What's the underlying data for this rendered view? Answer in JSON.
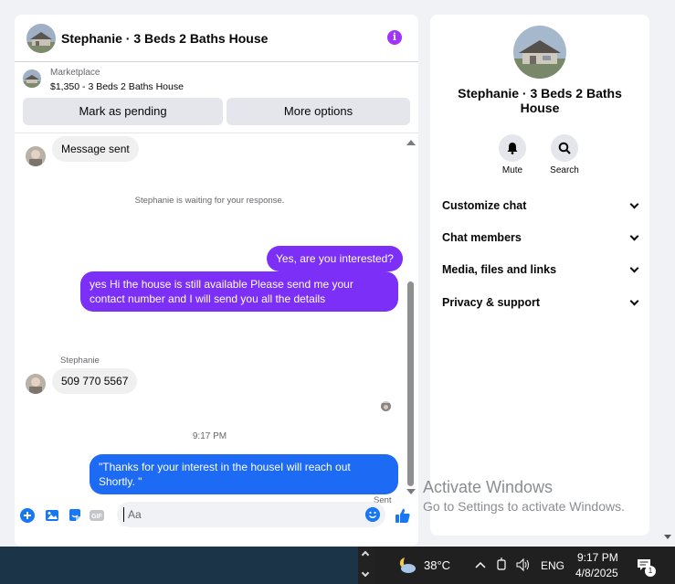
{
  "header": {
    "title": "Stephanie · 3 Beds 2 Baths House",
    "info_icon": "i"
  },
  "listing": {
    "source": "Marketplace",
    "price_title": "$1,350 - 3 Beds 2 Baths House",
    "btn_pending": "Mark as pending",
    "btn_more": "More options"
  },
  "messages": {
    "msg_sent": "Message sent",
    "waiting_note": "Stephanie is waiting for your response.",
    "out1": "Yes, are you interested?",
    "out2": "yes Hi the house is still available Please send me your contact number and I will send you all the details",
    "sender_name": "Stephanie",
    "in_phone": "509 770 5567",
    "time": "9:17 PM",
    "out3": "\"Thanks for your interest in the houseI will reach out Shortly. \"",
    "sent_label": "Sent"
  },
  "composer": {
    "placeholder": "Aa",
    "gif_label": "GIF"
  },
  "details": {
    "title": "Stephanie · 3 Beds 2 Baths House",
    "mute_label": "Mute",
    "search_label": "Search",
    "sections": [
      "Customize chat",
      "Chat members",
      "Media, files and links",
      "Privacy & support"
    ]
  },
  "activate": {
    "title": "Activate Windows",
    "subtitle": "Go to Settings to activate Windows."
  },
  "taskbar": {
    "temperature": "38°C",
    "language": "ENG",
    "time": "9:17 PM",
    "date": "4/8/2025",
    "notification_count": "1"
  },
  "colors": {
    "accent_purple": "#7b2ff7",
    "accent_blue": "#1d6af5",
    "messenger_blue": "#1877f2"
  }
}
